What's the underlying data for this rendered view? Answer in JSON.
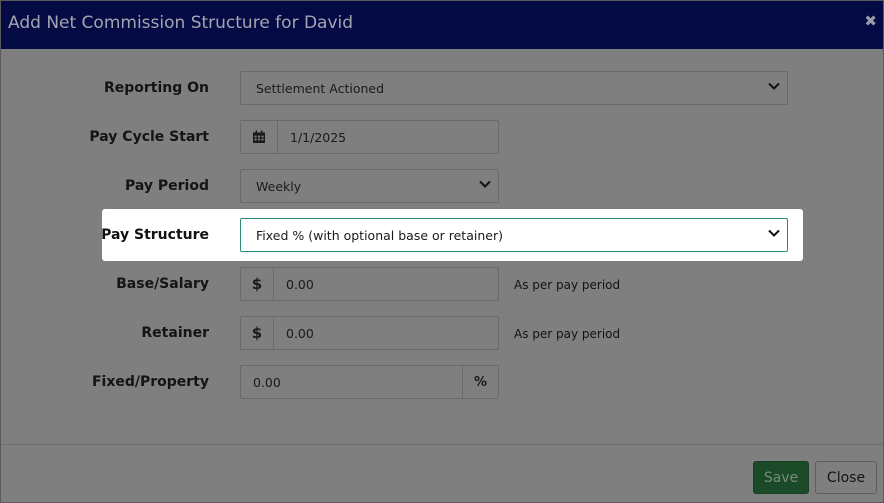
{
  "dialog": {
    "title": "Add Net Commission Structure for David",
    "close_glyph": "✖"
  },
  "form": {
    "reporting_on": {
      "label": "Reporting On",
      "value": "Settlement Actioned"
    },
    "pay_cycle_start": {
      "label": "Pay Cycle Start",
      "value": "1/1/2025"
    },
    "pay_period": {
      "label": "Pay Period",
      "value": "Weekly"
    },
    "pay_structure": {
      "label": "Pay Structure",
      "value": "Fixed % (with optional base or retainer)"
    },
    "base_salary": {
      "label": "Base/Salary",
      "prefix": "$",
      "value": "0.00",
      "hint": "As per pay period"
    },
    "retainer": {
      "label": "Retainer",
      "prefix": "$",
      "value": "0.00",
      "hint": "As per pay period"
    },
    "fixed_property": {
      "label": "Fixed/Property",
      "value": "0.00",
      "suffix": "%"
    }
  },
  "footer": {
    "save_label": "Save",
    "close_label": "Close"
  },
  "colors": {
    "header_bg": "#030a44",
    "save_bg": "#1b4a28",
    "highlight_border": "#2e8b7a"
  }
}
